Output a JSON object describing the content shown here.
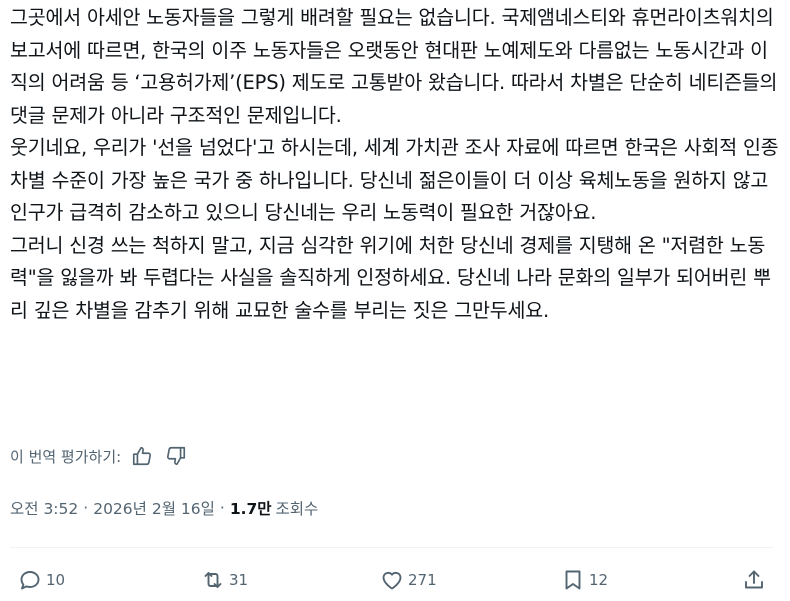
{
  "tweet": {
    "paragraphs": [
      "그곳에서 아세안 노동자들을 그렇게 배려할 필요는 없습니다. 국제앰네스티와 휴먼라이츠워치의 보고서에 따르면, 한국의 이주 노동자들은 오랫동안 현대판 노예제도와 다름없는 노동시간과 이직의 어려움 등 ‘고용허가제’(EPS) 제도로 고통받아 왔습니다. 따라서 차별은 단순히 네티즌들의 댓글 문제가 아니라 구조적인 문제입니다.",
      "웃기네요, 우리가 '선을 넘었다'고 하시는데, 세계 가치관 조사 자료에 따르면 한국은 사회적 인종차별 수준이 가장 높은 국가 중 하나입니다. 당신네 젊은이들이 더 이상 육체노동을 원하지 않고 인구가 급격히 감소하고 있으니 당신네는 우리 노동력이 필요한 거잖아요.",
      "그러니 신경 쓰는 척하지 말고, 지금 심각한 위기에 처한 당신네 경제를 지탱해 온 \"저렴한 노동력\"을 잃을까 봐 두렵다는 사실을 솔직하게 인정하세요. 당신네 나라 문화의 일부가 되어버린 뿌리 깊은 차별을 감추기 위해 교묘한 술수를 부리는 짓은 그만두세요."
    ]
  },
  "translation_rating": {
    "label": "이 번역 평가하기:",
    "icons": [
      "thumbs-up-icon",
      "thumbs-down-icon"
    ]
  },
  "meta": {
    "time": "오전 3:52",
    "separator": "·",
    "date": "2026년 2월 16일",
    "views_count": "1.7만",
    "views_label": "조회수"
  },
  "actions": {
    "replies": "10",
    "reposts": "31",
    "likes": "271",
    "bookmarks": "12"
  },
  "colors": {
    "text": "#0f1419",
    "secondary": "#536471",
    "divider": "#eff3f4"
  }
}
